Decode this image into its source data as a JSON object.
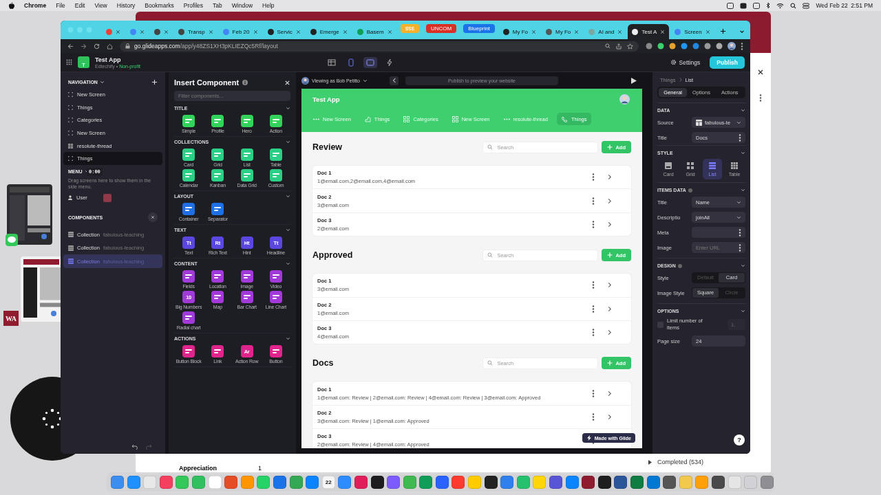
{
  "menubar": {
    "app": "Chrome",
    "items": [
      "File",
      "Edit",
      "View",
      "History",
      "Bookmarks",
      "Profiles",
      "Tab",
      "Window",
      "Help"
    ],
    "clock": "Wed Feb 22  2:51 PM"
  },
  "back_window": {
    "rows": [
      {
        "label": "Appreciation",
        "count": "1"
      }
    ],
    "status": "Completed (534)"
  },
  "desktop": {
    "app_badge": "WA",
    "timer": "0:00"
  },
  "browser": {
    "tabs": [
      {
        "kind": "tab",
        "color": "#ea4335",
        "selected": false
      },
      {
        "kind": "tab",
        "color": "#4285f4",
        "selected": false
      },
      {
        "kind": "tab",
        "color": "#444444",
        "selected": false
      },
      {
        "kind": "tab",
        "label": "Transp",
        "color": "#444444",
        "selected": false
      },
      {
        "kind": "tab",
        "label": "Feb 20",
        "color": "#4285f4",
        "selected": false
      },
      {
        "kind": "tab",
        "label": "Servic",
        "color": "#222222",
        "selected": false
      },
      {
        "kind": "tab",
        "label": "Emerge",
        "color": "#222222",
        "selected": false
      },
      {
        "kind": "tab",
        "label": "Basem",
        "color": "#0f9d58",
        "selected": false
      },
      {
        "kind": "group",
        "label": "$$$",
        "color": "#f6b12a"
      },
      {
        "kind": "group",
        "label": "UNCOM",
        "color": "#d93025"
      },
      {
        "kind": "group",
        "label": "Blueprint",
        "color": "#1a73e8"
      },
      {
        "kind": "tab",
        "label": "My Fo",
        "color": "#222222",
        "selected": false
      },
      {
        "kind": "tab",
        "label": "My Fo",
        "color": "#555555",
        "selected": false
      },
      {
        "kind": "tab",
        "label": "AI and",
        "color": "#7aa7a0",
        "selected": false
      },
      {
        "kind": "tab",
        "label": "Test A",
        "color": "#eeeeee",
        "selected": true
      },
      {
        "kind": "tab",
        "label": "Screen",
        "color": "#4285f4",
        "selected": false
      }
    ],
    "url_host": "go.glideapps.com",
    "url_path": "/app/y48ZS1XH3pKLIEZQc5Rf/layout"
  },
  "app_header": {
    "logo": "T",
    "title": "Test App",
    "org": "Edtechify •",
    "plan": "Non-profit",
    "devices": [
      {
        "kind": "table",
        "selected": false
      },
      {
        "kind": "phone",
        "selected": false
      },
      {
        "kind": "tablet",
        "selected": true
      },
      {
        "kind": "bolt",
        "selected": false
      }
    ],
    "settings": "Settings",
    "publish": "Publish"
  },
  "navigation": {
    "title": "NAVIGATION",
    "items": [
      {
        "label": "New Screen",
        "kind": "screen",
        "selected": false
      },
      {
        "label": "Things",
        "kind": "screen",
        "selected": false
      },
      {
        "label": "Categories",
        "kind": "screen",
        "selected": false
      },
      {
        "label": "New Screen",
        "kind": "screen",
        "selected": false
      },
      {
        "label": "resolute-thread",
        "kind": "table",
        "selected": false
      },
      {
        "label": "Things",
        "kind": "screen",
        "selected": true
      }
    ],
    "menu_title": "MENU",
    "menu_hint": "Drag screens here to show them in the side menu.",
    "menu_items": [
      "User"
    ],
    "components_title": "COMPONENTS",
    "components": [
      {
        "label": "Collection",
        "source": "fabulous-teaching",
        "selected": false
      },
      {
        "label": "Collection",
        "source": "fabulous-teaching",
        "selected": false
      },
      {
        "label": "Collection",
        "source": "fabulous-teaching",
        "selected": true
      }
    ]
  },
  "insert_panel": {
    "title": "Insert Component",
    "filter_placeholder": "Filter components...",
    "sections": [
      {
        "title": "TITLE",
        "color": "#32d35a",
        "items": [
          {
            "label": "Simple"
          },
          {
            "label": "Profile"
          },
          {
            "label": "Hero"
          },
          {
            "label": "Action"
          }
        ]
      },
      {
        "title": "COLLECTIONS",
        "color": "#2bcf86",
        "items": [
          {
            "label": "Card"
          },
          {
            "label": "Grid"
          },
          {
            "label": "List"
          },
          {
            "label": "Table"
          },
          {
            "label": "Calendar"
          },
          {
            "label": "Kanban"
          },
          {
            "label": "Data Grid"
          },
          {
            "label": "Custom"
          }
        ]
      },
      {
        "title": "LAYOUT",
        "color": "#1f6fe5",
        "items": [
          {
            "label": "Container"
          },
          {
            "label": "Separator"
          }
        ]
      },
      {
        "title": "TEXT",
        "color": "#5a47e0",
        "items": [
          {
            "label": "Text",
            "glyph": "Tt"
          },
          {
            "label": "Rich Text",
            "glyph": "Rt"
          },
          {
            "label": "Hint",
            "glyph": "Ht"
          },
          {
            "label": "Headline",
            "glyph": "Tt"
          }
        ]
      },
      {
        "title": "CONTENT",
        "color": "#a13ad8",
        "items": [
          {
            "label": "Fields"
          },
          {
            "label": "Location"
          },
          {
            "label": "Image"
          },
          {
            "label": "Video"
          },
          {
            "label": "Big Numbers",
            "glyph": "10"
          },
          {
            "label": "Map"
          },
          {
            "label": "Bar Chart"
          },
          {
            "label": "Line Chart"
          },
          {
            "label": "Radial chart"
          }
        ]
      },
      {
        "title": "ACTIONS",
        "color": "#e0248c",
        "items": [
          {
            "label": "Button Block"
          },
          {
            "label": "Link"
          },
          {
            "label": "Action Row",
            "glyph": "Ar"
          },
          {
            "label": "Button"
          }
        ]
      }
    ]
  },
  "preview": {
    "viewing_as": "Viewing as Bob Petitto",
    "url_placeholder": "Publish to preview your website",
    "app_title": "Test App",
    "tabs": [
      {
        "label": "New Screen",
        "kind": "dots",
        "selected": false
      },
      {
        "label": "Things",
        "kind": "shape",
        "selected": false
      },
      {
        "label": "Categories",
        "kind": "grid",
        "selected": false
      },
      {
        "label": "New Screen",
        "kind": "grid",
        "selected": false
      },
      {
        "label": "resolute-thread",
        "kind": "dots",
        "selected": false
      },
      {
        "label": "Things",
        "kind": "phone",
        "selected": true
      }
    ],
    "sections": [
      {
        "title": "Review",
        "search_placeholder": "Search",
        "add": "Add",
        "rows": [
          {
            "title": "Doc 1",
            "subtitle": "1@email.com,2@email.com,4@email.com"
          },
          {
            "title": "Doc 2",
            "subtitle": "3@email.com"
          },
          {
            "title": "Doc 3",
            "subtitle": "2@email.com"
          }
        ]
      },
      {
        "title": "Approved",
        "search_placeholder": "Search",
        "add": "Add",
        "rows": [
          {
            "title": "Doc 1",
            "subtitle": "3@email.com"
          },
          {
            "title": "Doc 2",
            "subtitle": "1@email.com"
          },
          {
            "title": "Doc 3",
            "subtitle": "4@email.com"
          }
        ]
      },
      {
        "title": "Docs",
        "search_placeholder": "Search",
        "add": "Add",
        "rows": [
          {
            "title": "Doc 1",
            "subtitle": "1@email.com: Review | 2@email.com: Review | 4@email.com: Review | 3@email.com: Approved"
          },
          {
            "title": "Doc 2",
            "subtitle": "3@email.com: Review | 1@email.com: Approved"
          },
          {
            "title": "Doc 3",
            "subtitle": "2@email.com: Review | 4@email.com: Approved"
          }
        ]
      }
    ],
    "badge": "Made with Glide"
  },
  "properties": {
    "breadcrumb": [
      "Things",
      "List"
    ],
    "tabs": [
      {
        "label": "General",
        "selected": true
      },
      {
        "label": "Options",
        "selected": false
      },
      {
        "label": "Actions",
        "selected": false
      }
    ],
    "data_title": "DATA",
    "source_label": "Source",
    "source_value": "fabulous-te",
    "title_label": "Title",
    "title_value": "Docs",
    "style_title": "STYLE",
    "styles": [
      {
        "label": "Card",
        "kind": "card",
        "selected": false
      },
      {
        "label": "Grid",
        "kind": "grid",
        "selected": false
      },
      {
        "label": "List",
        "kind": "list",
        "selected": true
      },
      {
        "label": "Table",
        "kind": "table",
        "selected": false
      }
    ],
    "items_title": "ITEMS DATA",
    "item_fields": [
      {
        "label": "Title",
        "kind": "select",
        "value": "Name"
      },
      {
        "label": "Descriptio",
        "kind": "select",
        "value": "joinAll"
      },
      {
        "label": "Meta",
        "kind": "menu"
      },
      {
        "label": "Image",
        "kind": "menu",
        "placeholder": "Enter URL"
      }
    ],
    "design_title": "DESIGN",
    "design_rows": [
      {
        "label": "Style",
        "options": [
          {
            "label": "Default",
            "selected": false
          },
          {
            "label": "Card",
            "selected": true
          }
        ]
      },
      {
        "label": "Image Style",
        "options": [
          {
            "label": "Square",
            "selected": true
          },
          {
            "label": "Circle",
            "selected": false
          }
        ]
      }
    ],
    "options_title": "OPTIONS",
    "limit_label": "Limit number of items",
    "limit_checked": false,
    "limit_value": "1.",
    "page_size_label": "Page size",
    "page_size": "24",
    "help": "?"
  },
  "dock": [
    {
      "color": "#3b8ef0"
    },
    {
      "color": "#1e90ff"
    },
    {
      "color": "#e8e8e8"
    },
    {
      "color": "#f43f5e"
    },
    {
      "color": "#34c759"
    },
    {
      "color": "#30c060"
    },
    {
      "color": "#ffffff"
    },
    {
      "color": "#e44d26"
    },
    {
      "color": "#ff9500"
    },
    {
      "color": "#25d366"
    },
    {
      "color": "#1a73e8"
    },
    {
      "color": "#34a853"
    },
    {
      "color": "#0b84ff"
    },
    {
      "color": "#f5f5f5",
      "label": "22"
    },
    {
      "color": "#2d8cff"
    },
    {
      "color": "#e01e5a"
    },
    {
      "color": "#1d1d1f"
    },
    {
      "color": "#7c5cff"
    },
    {
      "color": "#3fb950"
    },
    {
      "color": "#0f9d58"
    },
    {
      "color": "#2962ff"
    },
    {
      "color": "#ff3b30"
    },
    {
      "color": "#ffcc00"
    },
    {
      "color": "#222222"
    },
    {
      "color": "#2f80ed"
    },
    {
      "color": "#25c16f"
    },
    {
      "color": "#ffd60a"
    },
    {
      "color": "#5856d6"
    },
    {
      "color": "#0a84ff"
    },
    {
      "color": "#8e1b2e"
    },
    {
      "color": "#1e1e1e"
    },
    {
      "color": "#2b579a"
    },
    {
      "color": "#107c41"
    },
    {
      "color": "#0078d4"
    },
    {
      "color": "#555555"
    },
    {
      "color": "#f2c94c"
    },
    {
      "color": "#ff9f0a"
    },
    {
      "color": "#4a4a4a"
    },
    {
      "color": "#e5e5e5"
    },
    {
      "color": "#d1d1d6"
    },
    {
      "color": "#8e8e93"
    }
  ]
}
